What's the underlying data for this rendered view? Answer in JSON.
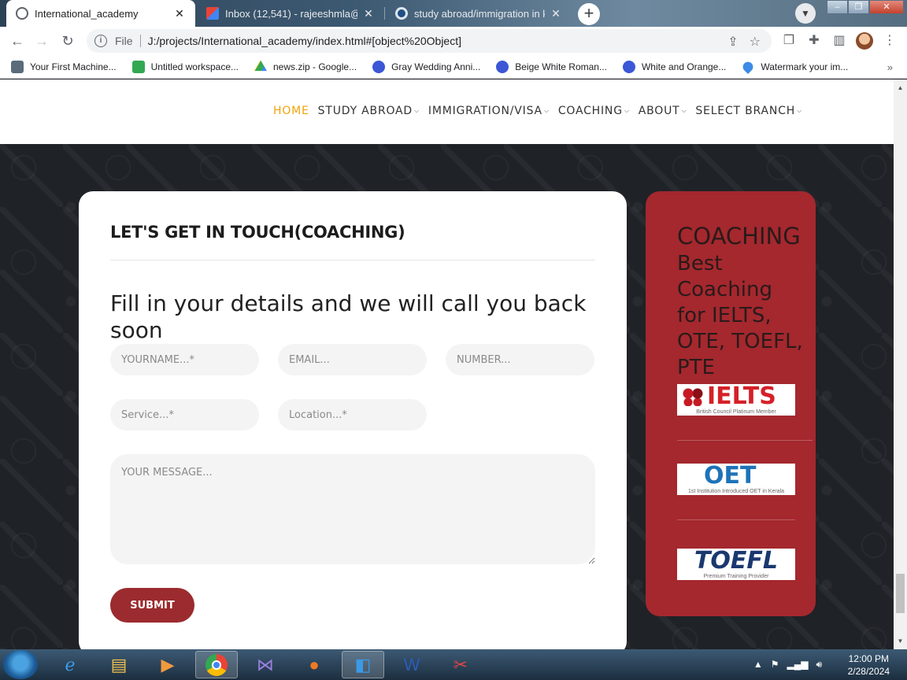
{
  "browser": {
    "tabs": [
      {
        "title": "International_academy",
        "active": true
      },
      {
        "title": "Inbox (12,541) - rajeeshmla@gma",
        "active": false
      },
      {
        "title": "study abroad/immigration in kera",
        "active": false
      }
    ],
    "url_scheme": "File",
    "url": "J:/projects/International_academy/index.html#[object%20Object]"
  },
  "bookmarks": [
    {
      "label": "Your First Machine..."
    },
    {
      "label": "Untitled workspace..."
    },
    {
      "label": "news.zip - Google..."
    },
    {
      "label": "Gray Wedding Anni..."
    },
    {
      "label": "Beige White Roman..."
    },
    {
      "label": "White and Orange..."
    },
    {
      "label": "Watermark your im..."
    }
  ],
  "site": {
    "nav": [
      {
        "label": "HOME",
        "active": true,
        "caret": false
      },
      {
        "label": "STUDY ABROAD",
        "active": false,
        "caret": true
      },
      {
        "label": "IMMIGRATION/VISA",
        "active": false,
        "caret": true
      },
      {
        "label": "COACHING",
        "active": false,
        "caret": true
      },
      {
        "label": "ABOUT",
        "active": false,
        "caret": true
      },
      {
        "label": "SELECT BRANCH",
        "active": false,
        "caret": true
      }
    ],
    "form": {
      "heading": "LET'S GET IN TOUCH(COACHING)",
      "subheading": "Fill in your details and we will call you back soon",
      "placeholders": {
        "name": "YOURNAME...*",
        "email": "EMAIL...",
        "number": "NUMBER...",
        "service": "Service...*",
        "location": "Location...*",
        "message": "YOUR MESSAGE..."
      },
      "submit_label": "SUBMIT"
    },
    "sidebar": {
      "title": "COACHING",
      "subtitle": "Best Coaching for IELTS, OTE, TOEFL, PTE",
      "logos": {
        "ielts": {
          "text": "IELTS",
          "caption": "British Council Platinum Member"
        },
        "oet": {
          "text": "OET",
          "caption": "1st Institution Introduced OET in Kerala"
        },
        "toefl": {
          "text": "TOEFL",
          "caption": "Premium Training Provider"
        }
      }
    },
    "colors": {
      "accent": "#f0a30a",
      "brand_red": "#a4282e",
      "button": "#9b2b2e"
    }
  },
  "taskbar": {
    "time": "12:00 PM",
    "date": "2/28/2024"
  }
}
